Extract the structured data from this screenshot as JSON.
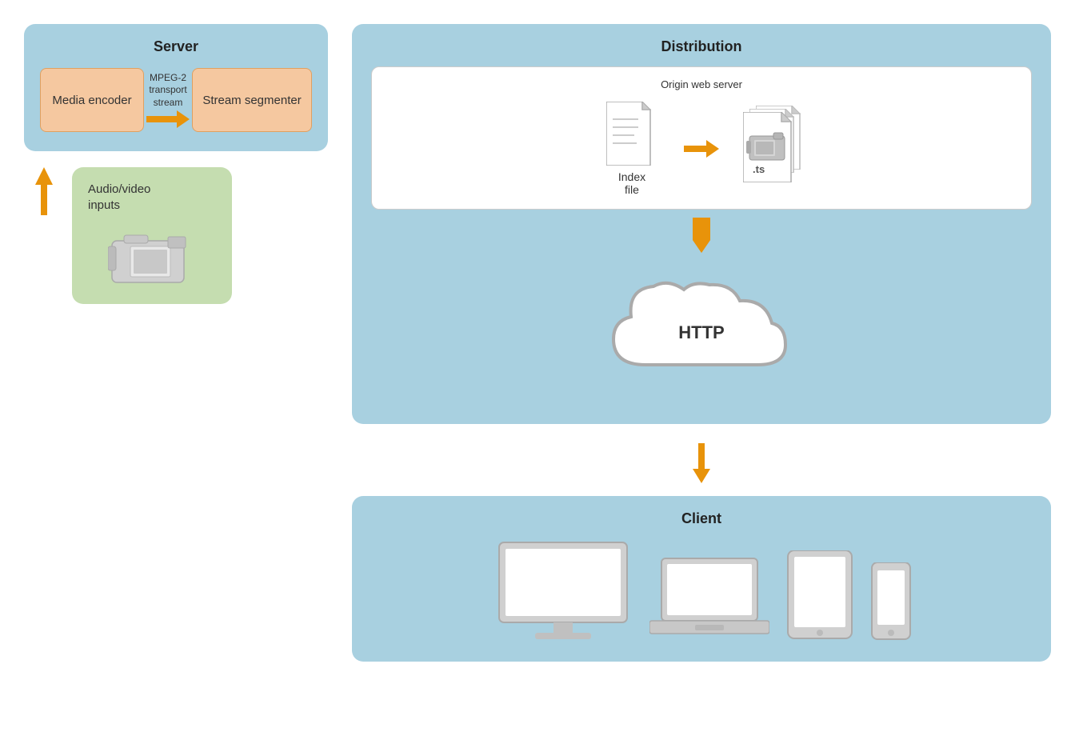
{
  "server": {
    "title": "Server",
    "media_encoder_label": "Media encoder",
    "stream_segmenter_label": "Stream segmenter",
    "mpeg_label": "MPEG-2\ntransport\nstream"
  },
  "av": {
    "title": "Audio/video\ninputs"
  },
  "distribution": {
    "title": "Distribution",
    "origin_label": "Origin web server",
    "index_file_label": "Index\nfile",
    "ts_label": ".ts"
  },
  "cloud": {
    "label": "HTTP"
  },
  "client": {
    "title": "Client"
  },
  "colors": {
    "blue_bg": "#a8d4e3",
    "orange_box": "#f5c8a0",
    "green_bg": "#c5ddb0",
    "arrow_orange": "#e8930a",
    "white": "#ffffff"
  }
}
